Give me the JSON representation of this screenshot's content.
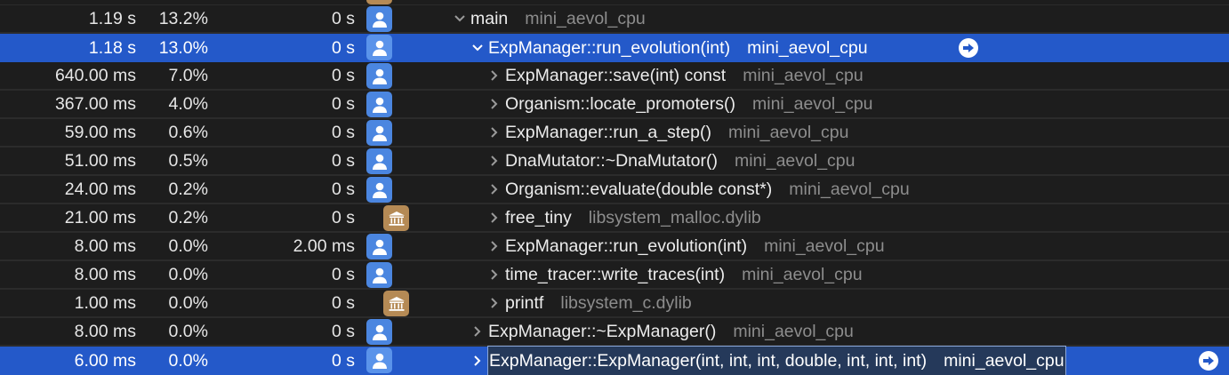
{
  "rows": [
    {
      "weight": "1.19 s",
      "percent": "13.2%",
      "self": "0 s",
      "icon": "user-icon",
      "symbol": "main",
      "library": "mini_aevol_cpu",
      "depth": 0,
      "expanded": true,
      "selected": false
    },
    {
      "weight": "1.18 s",
      "percent": "13.0%",
      "self": "0 s",
      "icon": "user-icon",
      "symbol": "ExpManager::run_evolution(int)",
      "library": "mini_aevol_cpu",
      "depth": 1,
      "expanded": true,
      "selected": true
    },
    {
      "weight": "640.00 ms",
      "percent": "7.0%",
      "self": "0 s",
      "icon": "user-icon",
      "symbol": "ExpManager::save(int) const",
      "library": "mini_aevol_cpu",
      "depth": 2,
      "expanded": false,
      "selected": false
    },
    {
      "weight": "367.00 ms",
      "percent": "4.0%",
      "self": "0 s",
      "icon": "user-icon",
      "symbol": "Organism::locate_promoters()",
      "library": "mini_aevol_cpu",
      "depth": 2,
      "expanded": false,
      "selected": false
    },
    {
      "weight": "59.00 ms",
      "percent": "0.6%",
      "self": "0 s",
      "icon": "user-icon",
      "symbol": "ExpManager::run_a_step()",
      "library": "mini_aevol_cpu",
      "depth": 2,
      "expanded": false,
      "selected": false
    },
    {
      "weight": "51.00 ms",
      "percent": "0.5%",
      "self": "0 s",
      "icon": "user-icon",
      "symbol": "DnaMutator::~DnaMutator()",
      "library": "mini_aevol_cpu",
      "depth": 2,
      "expanded": false,
      "selected": false
    },
    {
      "weight": "24.00 ms",
      "percent": "0.2%",
      "self": "0 s",
      "icon": "user-icon",
      "symbol": "Organism::evaluate(double const*)",
      "library": "mini_aevol_cpu",
      "depth": 2,
      "expanded": false,
      "selected": false
    },
    {
      "weight": "21.00 ms",
      "percent": "0.2%",
      "self": "0 s",
      "icon": "library-icon",
      "symbol": "free_tiny",
      "library": "libsystem_malloc.dylib",
      "depth": 2,
      "expanded": false,
      "selected": false
    },
    {
      "weight": "8.00 ms",
      "percent": "0.0%",
      "self": "2.00 ms",
      "icon": "user-icon",
      "symbol": "ExpManager::run_evolution(int)",
      "library": "mini_aevol_cpu",
      "depth": 2,
      "expanded": false,
      "selected": false
    },
    {
      "weight": "8.00 ms",
      "percent": "0.0%",
      "self": "0 s",
      "icon": "user-icon",
      "symbol": "time_tracer::write_traces(int)",
      "library": "mini_aevol_cpu",
      "depth": 2,
      "expanded": false,
      "selected": false
    },
    {
      "weight": "1.00 ms",
      "percent": "0.0%",
      "self": "0 s",
      "icon": "library-icon",
      "symbol": "printf",
      "library": "libsystem_c.dylib",
      "depth": 2,
      "expanded": false,
      "selected": false
    },
    {
      "weight": "8.00 ms",
      "percent": "0.0%",
      "self": "0 s",
      "icon": "user-icon",
      "symbol": "ExpManager::~ExpManager()",
      "library": "mini_aevol_cpu",
      "depth": 1,
      "expanded": false,
      "selected": false
    },
    {
      "weight": "6.00 ms",
      "percent": "0.0%",
      "self": "0 s",
      "icon": "user-icon",
      "symbol": "ExpManager::ExpManager(int, int, int, double, int, int, int)",
      "library": "mini_aevol_cpu",
      "depth": 1,
      "expanded": false,
      "selected": true,
      "editing": true
    }
  ],
  "colors": {
    "selection": "#2459c9",
    "user_icon": "#4b86e0",
    "library_icon": "#b58a55"
  }
}
